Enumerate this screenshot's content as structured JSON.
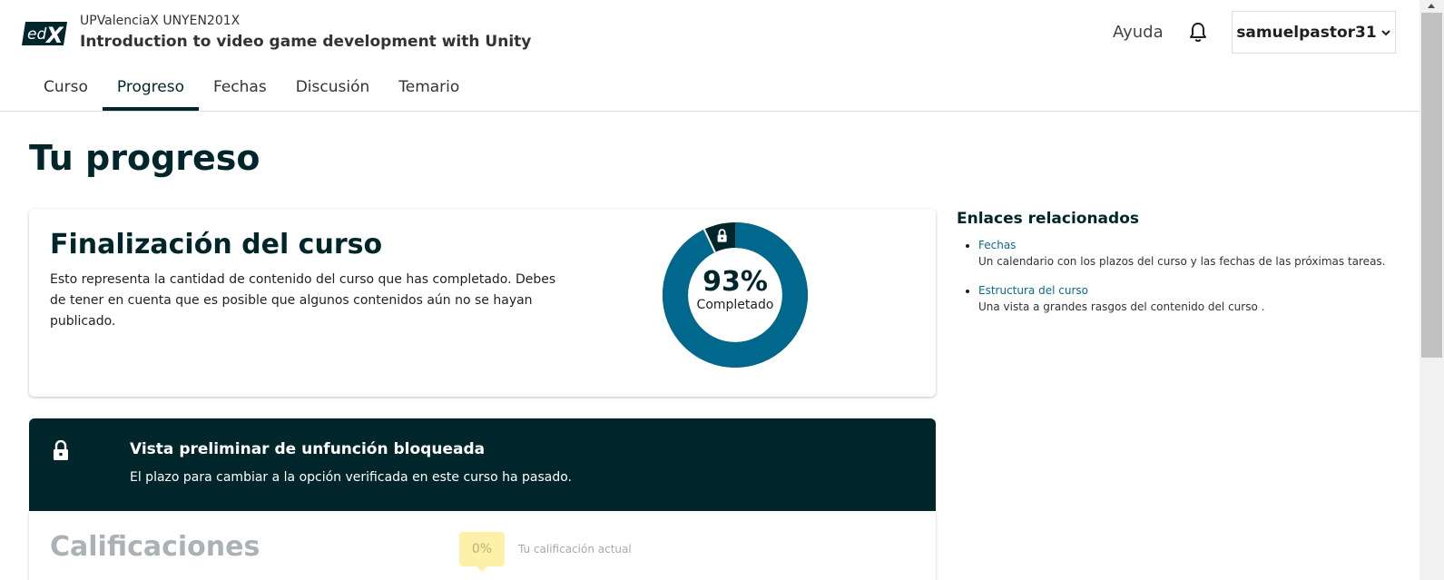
{
  "header": {
    "org_line": "UPValenciaX UNYEN201X",
    "course_title": "Introduction to video game development with Unity",
    "help_label": "Ayuda",
    "username": "samuelpastor31",
    "logo_icon": "edx-logo-icon"
  },
  "nav": {
    "tabs": [
      {
        "label": "Curso",
        "active": false
      },
      {
        "label": "Progreso",
        "active": true
      },
      {
        "label": "Fechas",
        "active": false
      },
      {
        "label": "Discusión",
        "active": false
      },
      {
        "label": "Temario",
        "active": false
      }
    ]
  },
  "page": {
    "title": "Tu progreso"
  },
  "completion": {
    "title": "Finalización del curso",
    "description": "Esto representa la cantidad de contenido del curso que has completado. Debes de tener en cuenta que es posible que algunos contenidos aún no se hayan publicado.",
    "percent_label": "93%",
    "percent_value": 93,
    "status_label": "Completado",
    "colors": {
      "complete": "#00688d",
      "locked": "#00262b"
    }
  },
  "locked_banner": {
    "title": "Vista preliminar de unfunción bloqueada",
    "text": "El plazo para cambiar a la opción verificada en este curso ha pasado."
  },
  "grades": {
    "title": "Calificaciones",
    "current_grade": "0%",
    "current_grade_label": "Tu calificación actual"
  },
  "related": {
    "title": "Enlaces relacionados",
    "items": [
      {
        "label": "Fechas",
        "description": "Un calendario con los plazos del curso y las fechas de las próximas tareas."
      },
      {
        "label": "Estructura del curso",
        "description": "Una vista a grandes rasgos del contenido del curso ."
      }
    ]
  }
}
